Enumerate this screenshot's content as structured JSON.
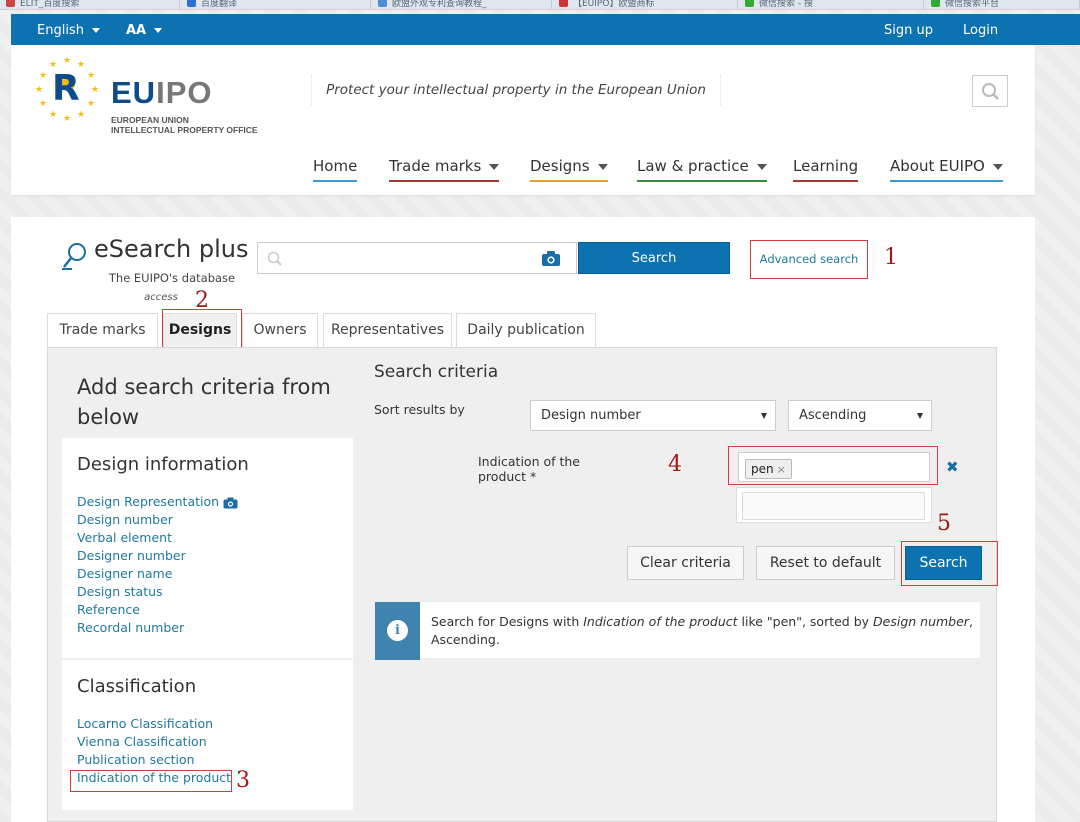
{
  "browser_tabs": [
    {
      "label": "ELIT_百度搜索",
      "color": "#c44"
    },
    {
      "label": "百度翻译",
      "color": "#2e6fd6"
    },
    {
      "label": "欧盟外观专利查询教程_",
      "color": "#4a8fd6"
    },
    {
      "label": "【EUIPO】欧盟商标",
      "color": "#c33"
    },
    {
      "label": "微信搜索 - 搜",
      "color": "#3a3"
    },
    {
      "label": "微信搜索平台",
      "color": "#3a3"
    }
  ],
  "topbar": {
    "language": "English",
    "font_size": "AA",
    "signup": "Sign up",
    "login": "Login"
  },
  "header": {
    "logo_main_eu": "EU",
    "logo_main_ipo": "IPO",
    "logo_sub_line1": "EUROPEAN UNION",
    "logo_sub_line2": "INTELLECTUAL PROPERTY OFFICE",
    "tagline": "Protect your intellectual property in the European Union"
  },
  "nav": [
    {
      "label": "Home",
      "underline": "#3b9bd0",
      "dropdown": false
    },
    {
      "label": "Trade marks",
      "underline": "#a33a2e",
      "dropdown": true
    },
    {
      "label": "Designs",
      "underline": "#e0a51f",
      "dropdown": true
    },
    {
      "label": "Law & practice",
      "underline": "#3c8a3c",
      "dropdown": true
    },
    {
      "label": "Learning",
      "underline": "#a33a2e",
      "dropdown": false
    },
    {
      "label": "About EUIPO",
      "underline": "#3b9bd0",
      "dropdown": true
    }
  ],
  "esearch": {
    "title": "eSearch plus",
    "subtitle": "The EUIPO's database",
    "subtitle2": "access",
    "search_button": "Search",
    "advanced_search": "Advanced search"
  },
  "annotations": {
    "a1": "1",
    "a2": "2",
    "a3": "3",
    "a4": "4",
    "a5": "5"
  },
  "tabs": [
    {
      "label": "Trade marks",
      "active": false
    },
    {
      "label": "Designs",
      "active": true
    },
    {
      "label": "Owners",
      "active": false
    },
    {
      "label": "Representatives",
      "active": false
    },
    {
      "label": "Daily publication",
      "active": false
    }
  ],
  "left": {
    "heading": "Add search criteria from below",
    "design_info_title": "Design information",
    "design_info_links": [
      "Design Representation",
      "Design number",
      "Verbal element",
      "Designer number",
      "Designer name",
      "Design status",
      "Reference",
      "Recordal number"
    ],
    "classification_title": "Classification",
    "classification_links": [
      "Locarno Classification",
      "Vienna Classification",
      "Publication section",
      "Indication of the product"
    ]
  },
  "right": {
    "title": "Search criteria",
    "sort_label": "Sort results by",
    "sort_field": "Design number",
    "sort_order": "Ascending",
    "indication_label": "Indication of the product *",
    "tag_value": "pen",
    "clear_button": "Clear criteria",
    "reset_button": "Reset to default",
    "search_button": "Search",
    "info_parts": {
      "p1": "Search for Designs with ",
      "p2": "Indication of the product",
      "p3": " like \"pen\", sorted by ",
      "p4": "Design number",
      "p5": ", Ascending."
    }
  },
  "colors": {
    "primary_blue": "#0c73b0",
    "link_blue": "#207a9c",
    "annotation_red": "#d43c3c",
    "logo_yellow": "#f3bd19"
  }
}
